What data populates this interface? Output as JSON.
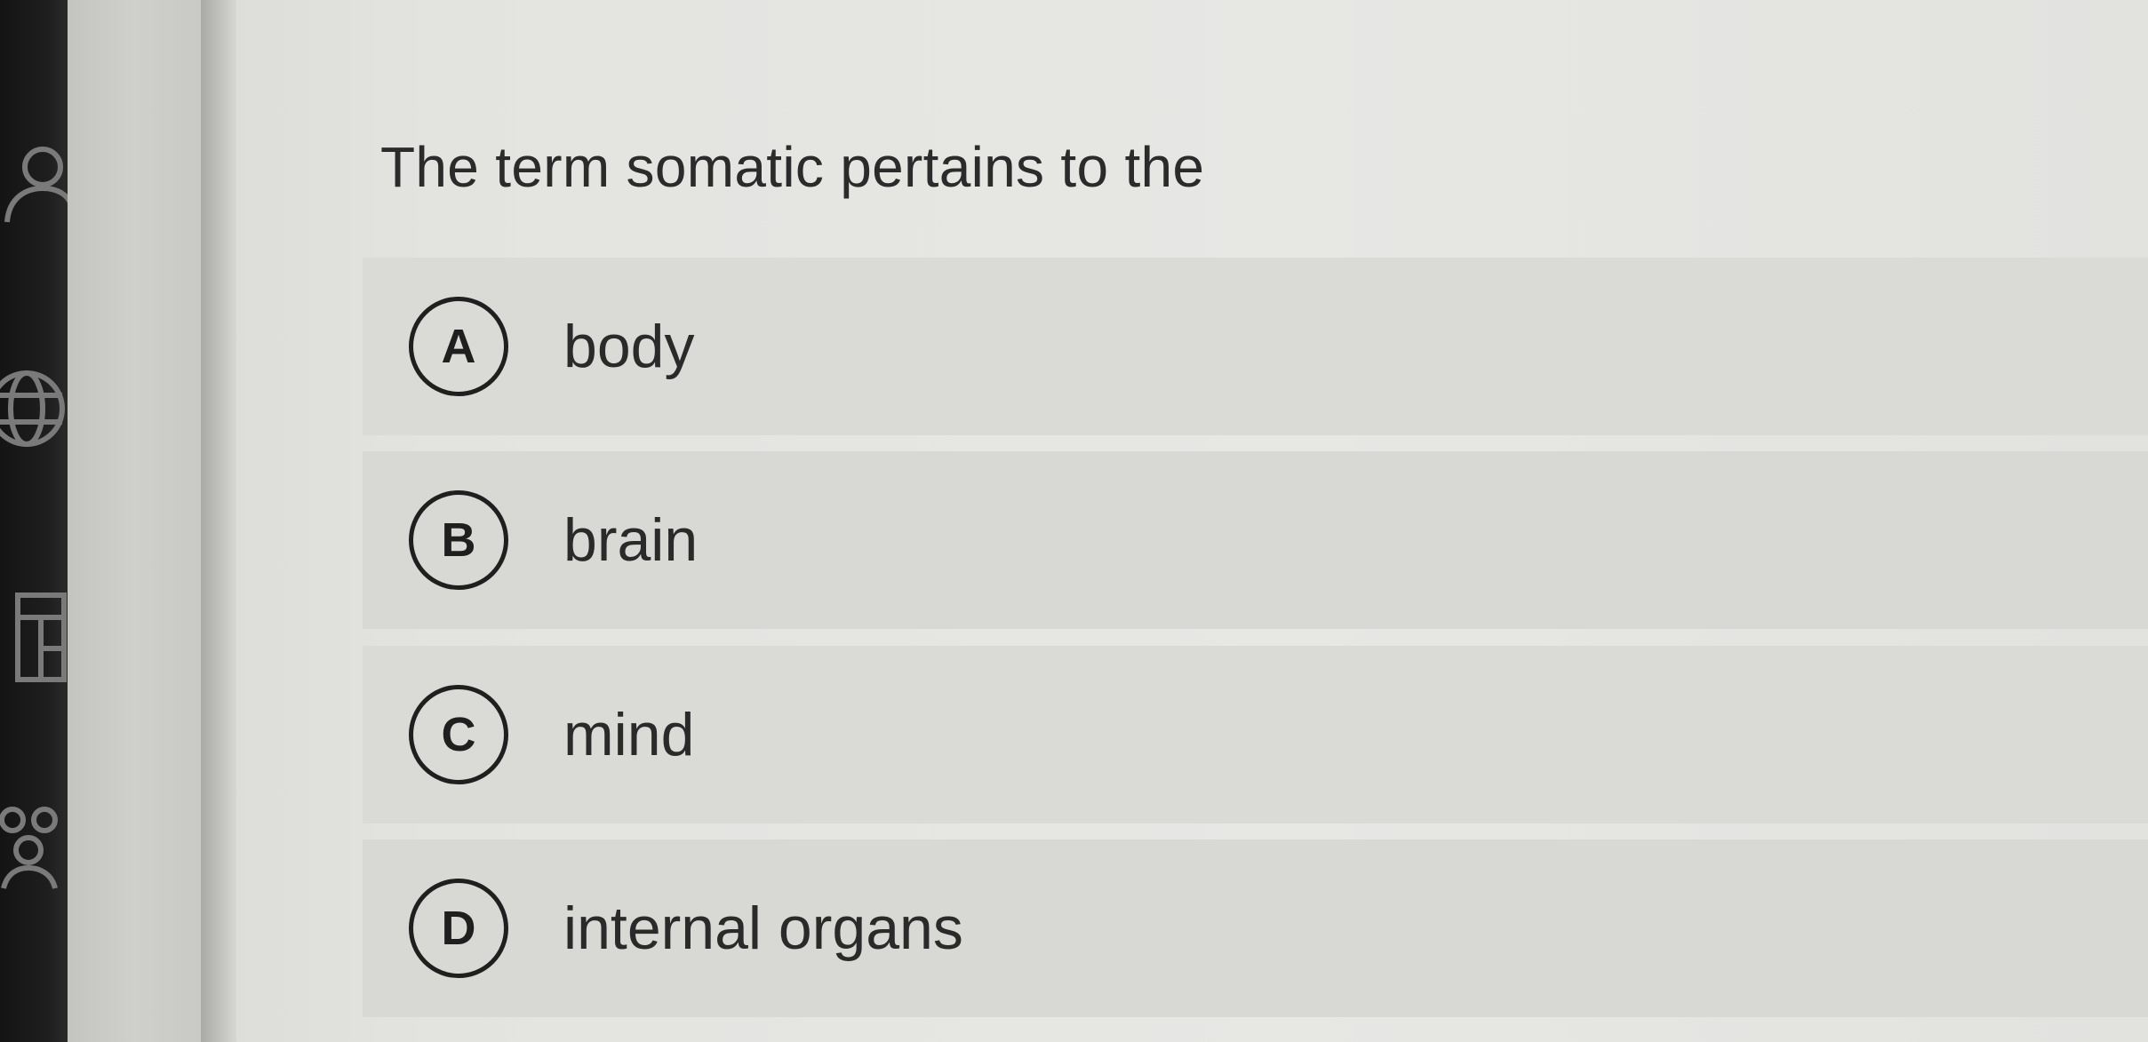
{
  "nav": {
    "icons": [
      "user-icon",
      "globe-icon",
      "layout-icon",
      "group-icon"
    ]
  },
  "question": {
    "text": "The term somatic pertains to the"
  },
  "options": [
    {
      "letter": "A",
      "label": "body"
    },
    {
      "letter": "B",
      "label": "brain"
    },
    {
      "letter": "C",
      "label": "mind"
    },
    {
      "letter": "D",
      "label": "internal organs"
    }
  ]
}
